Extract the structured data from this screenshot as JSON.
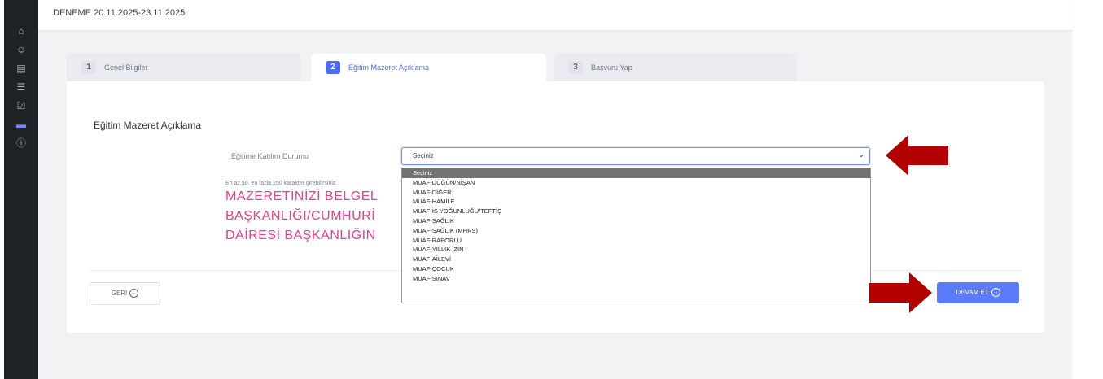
{
  "page": {
    "title": "DENEME 20.11.2025-23.11.2025"
  },
  "sidebar": {
    "icons": [
      "home-icon",
      "user-check-icon",
      "id-card-icon",
      "clipboard-icon",
      "checkbox-icon",
      "card-icon",
      "help-icon"
    ]
  },
  "tabs": [
    {
      "num": "1",
      "label": "Genel Bilgiler",
      "active": false
    },
    {
      "num": "2",
      "label": "Eğitim Mazeret Açıklama",
      "active": true
    },
    {
      "num": "3",
      "label": "Başvuru Yap",
      "active": false
    }
  ],
  "form": {
    "section_title": "Eğitim Mazeret Açıklama",
    "participation_label": "Eğitime Katılım Durumu",
    "participation_value": "Seçiniz",
    "hint": "En az 50, en fazla 250 karakter girebilirsiniz.",
    "warning_lines": [
      "MAZERETİNİZİ BELGEL",
      "BAŞKANLIĞI/CUMHURİ",
      "DAİRESİ BAŞKANLIĞIN"
    ]
  },
  "dropdown": {
    "options": [
      "Seçiniz",
      "MUAF-DÜĞÜN/NİŞAN",
      "MUAF-DİĞER",
      "MUAF-HAMİLE",
      "MUAF-İŞ YOĞUNLUĞU/TEFTİŞ",
      "MUAF-SAĞLIK",
      "MUAF-SAĞLIK (MHRS)",
      "MUAF-RAPORLU",
      "MUAF-YILLIK İZİN",
      "MUAF-AİLEVİ",
      "MUAF-ÇOCUK",
      "MUAF-SINAV"
    ],
    "selected_index": 0
  },
  "buttons": {
    "back": "GERİ",
    "next": "DEVAM ET"
  },
  "colors": {
    "accent": "#4a6cf7",
    "warning_text": "#e83e8c",
    "annotation_arrow": "#b30000",
    "sidebar": "#1f2327"
  }
}
